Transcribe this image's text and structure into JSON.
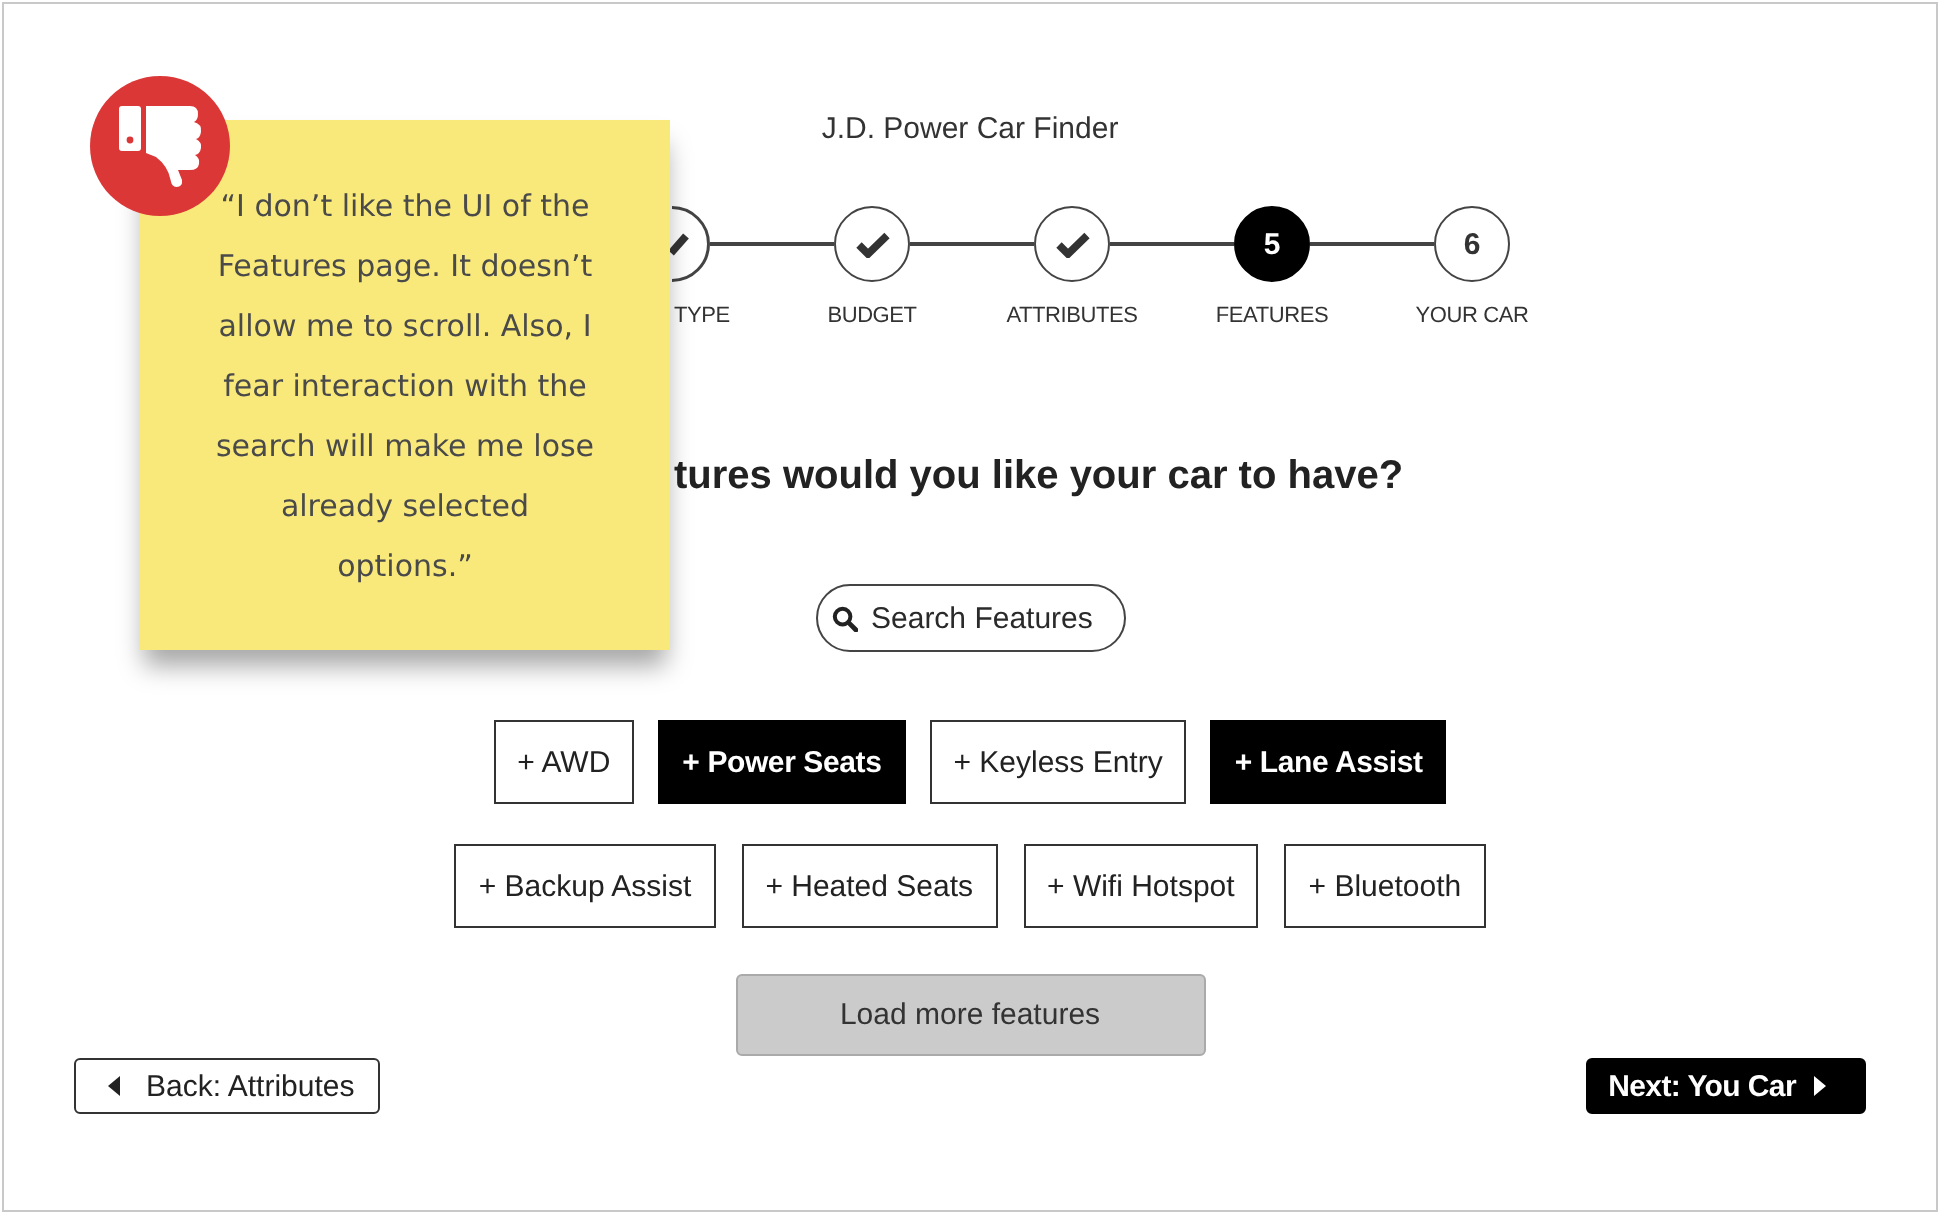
{
  "note": {
    "kind": "negative",
    "quote": "“I don’t like the UI of the Features page. It doesn’t allow me to scroll. Also, I fear interaction with the search will make me lose already selected options.”"
  },
  "app": {
    "title": "J.D. Power Car Finder"
  },
  "steps": [
    {
      "kind": "cut",
      "label": "TYPE",
      "completed": true,
      "selected": false
    },
    {
      "kind": "full",
      "label": "BUDGET",
      "completed": true,
      "selected": false
    },
    {
      "kind": "full",
      "label": "ATTRIBUTES",
      "completed": true,
      "selected": false
    },
    {
      "kind": "full",
      "number": "5",
      "label": "FEATURES",
      "completed": false,
      "selected": true
    },
    {
      "kind": "full",
      "number": "6",
      "label": "YOUR CAR",
      "completed": false,
      "selected": false
    }
  ],
  "heading": "tures would you like your car to have?",
  "search": {
    "placeholder": "Search Features"
  },
  "feature_rows": [
    [
      {
        "label": "+ AWD",
        "selected": false
      },
      {
        "label": "+ Power Seats",
        "selected": true
      },
      {
        "label": "+ Keyless Entry",
        "selected": false
      },
      {
        "label": "+ Lane Assist",
        "selected": true
      }
    ],
    [
      {
        "label": "+ Backup Assist",
        "selected": false
      },
      {
        "label": "+ Heated Seats",
        "selected": false
      },
      {
        "label": "+ Wifi Hotspot",
        "selected": false
      },
      {
        "label": "+ Bluetooth",
        "selected": false
      }
    ]
  ],
  "load_more": {
    "label": "Load more features"
  },
  "back_button": {
    "label": "Back: Attributes"
  },
  "next_button": {
    "label": "Next: You Car"
  }
}
